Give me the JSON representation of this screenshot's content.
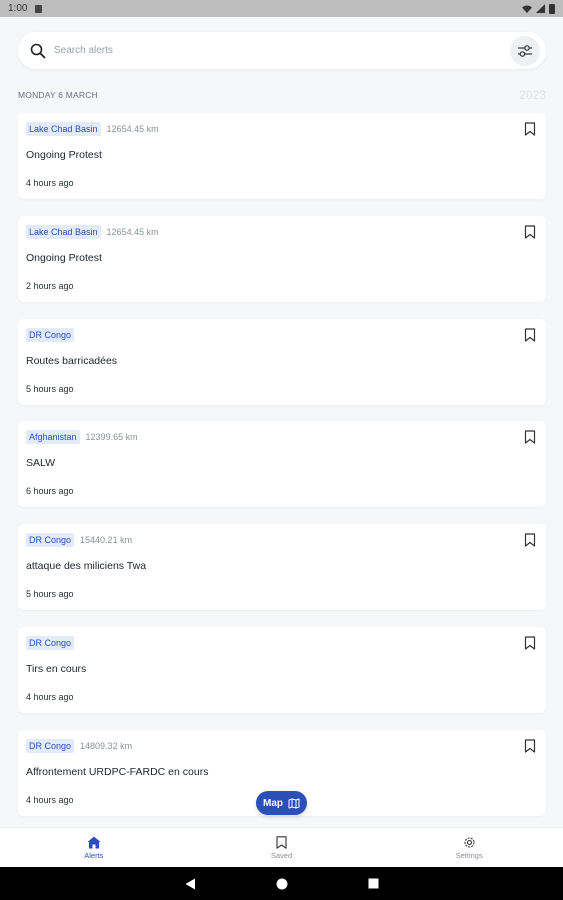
{
  "status": {
    "time": "1:00"
  },
  "search": {
    "placeholder": "Search alerts"
  },
  "section": {
    "date": "MONDAY 6 MARCH",
    "year": "2023"
  },
  "alerts": [
    {
      "tag": "Lake Chad Basin",
      "distance": "12654.45 km",
      "title": "Ongoing Protest",
      "time": "4 hours ago"
    },
    {
      "tag": "Lake Chad Basin",
      "distance": "12654.45 km",
      "title": "Ongoing Protest",
      "time": "2 hours ago"
    },
    {
      "tag": "DR Congo",
      "distance": "",
      "title": "Routes barricadées",
      "time": "5 hours ago"
    },
    {
      "tag": "Afghanistan",
      "distance": "12399.65 km",
      "title": "SALW",
      "time": "6 hours ago"
    },
    {
      "tag": "DR Congo",
      "distance": "15440.21 km",
      "title": "attaque des miliciens Twa",
      "time": "5 hours ago"
    },
    {
      "tag": "DR Congo",
      "distance": "",
      "title": "Tirs en cours",
      "time": "4 hours ago"
    },
    {
      "tag": "DR Congo",
      "distance": "14809.32 km",
      "title": "Affrontement URDPC-FARDC en cours",
      "time": "4 hours ago"
    }
  ],
  "map_button": {
    "label": "Map"
  },
  "nav": {
    "items": [
      {
        "label": "Alerts",
        "icon": "home-icon",
        "active": true
      },
      {
        "label": "Saved",
        "icon": "bookmark-icon",
        "active": false
      },
      {
        "label": "Settings",
        "icon": "gear-icon",
        "active": false
      }
    ]
  },
  "colors": {
    "accent": "#2a4fb8",
    "tag_bg": "#e3ebfb",
    "background": "#f6f7f9"
  }
}
